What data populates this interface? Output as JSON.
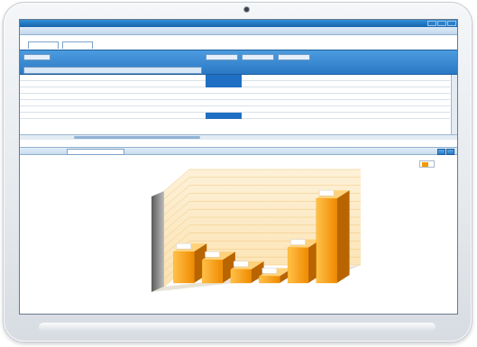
{
  "window": {
    "title": ""
  },
  "menu": [
    {
      "label": ""
    },
    {
      "label": ""
    },
    {
      "label": ""
    }
  ],
  "tabs": [
    {
      "label": ""
    },
    {
      "label": ""
    }
  ],
  "filters": [
    {
      "label": ""
    },
    {
      "label": ""
    },
    {
      "label": ""
    },
    {
      "label": ""
    }
  ],
  "grid": {
    "row_header": "",
    "column_headers": [
      "",
      "",
      "",
      "",
      "",
      "",
      "",
      "",
      ""
    ],
    "rows": [
      {
        "label": "",
        "values": [
          "",
          "",
          "",
          "",
          "",
          "",
          "",
          ""
        ]
      },
      {
        "label": "",
        "values": [
          "",
          "",
          "",
          "",
          "",
          "",
          "",
          ""
        ]
      },
      {
        "label": "",
        "values": [
          "",
          "",
          "",
          "",
          "",
          "",
          "",
          ""
        ]
      },
      {
        "label": "",
        "values": [
          "",
          "",
          "",
          "",
          "",
          "",
          "",
          ""
        ]
      },
      {
        "label": "",
        "values": [
          "",
          "",
          "",
          "",
          "",
          "",
          "",
          ""
        ]
      },
      {
        "label": "",
        "values": [
          "",
          "",
          "",
          "",
          "",
          "",
          "",
          ""
        ]
      },
      {
        "label": "",
        "values": [
          "",
          "",
          "",
          "",
          "",
          "",
          "",
          ""
        ]
      }
    ]
  },
  "chart_panel": {
    "type_label": "",
    "type_value": ""
  },
  "colors": {
    "bar": "#f39a00",
    "accent_blue": "#2a78c4",
    "selection": "#1f6fc4"
  },
  "chart_data": {
    "type": "bar",
    "style": "3d-bars",
    "ylim": [
      0,
      7000
    ],
    "y_ticks": [
      "",
      "",
      "",
      "",
      "",
      "",
      "",
      "",
      "",
      "",
      "",
      "",
      ""
    ],
    "values": [
      2300,
      1700,
      1000,
      500,
      2600,
      6200
    ],
    "bar_labels": [
      "",
      "",
      "",
      "",
      "",
      ""
    ],
    "legend": [
      ""
    ],
    "grid": true,
    "legend_position": "top-right"
  }
}
